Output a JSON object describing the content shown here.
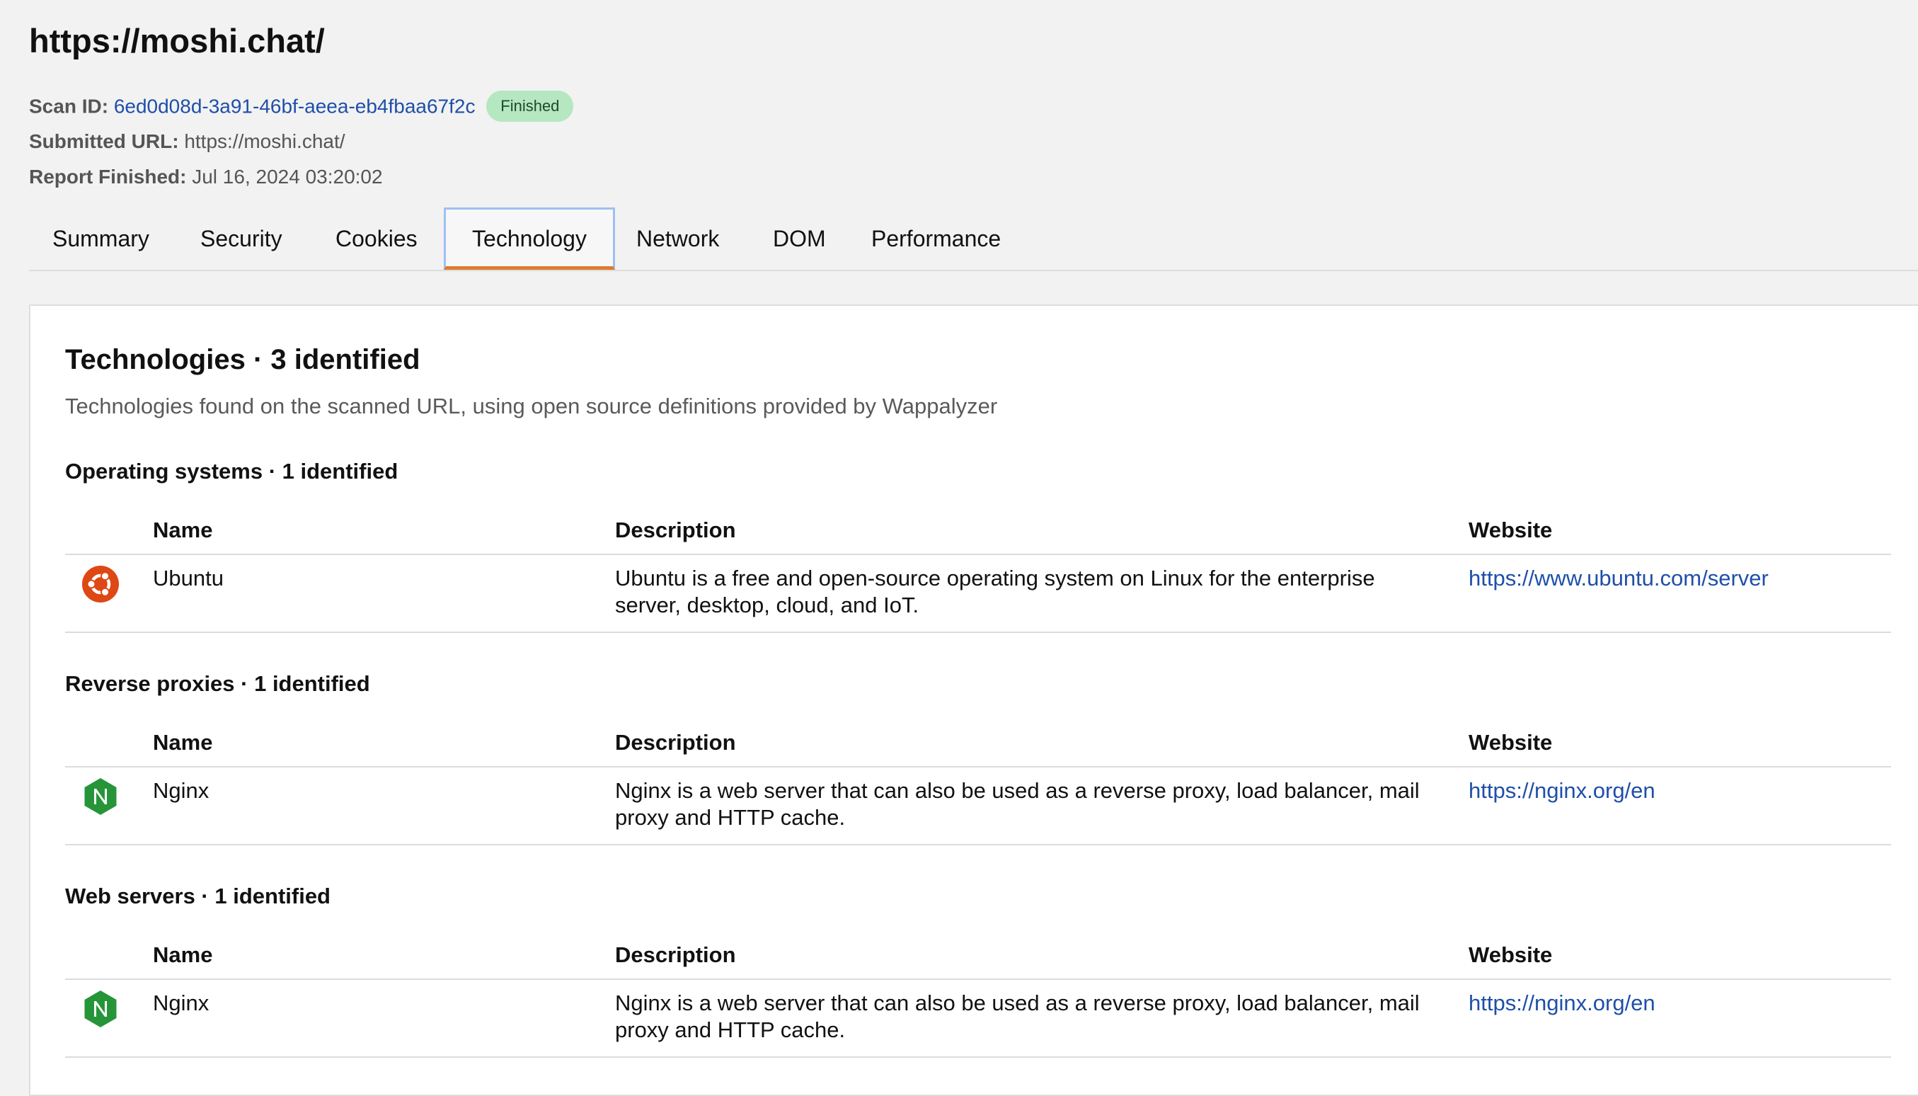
{
  "header": {
    "title": "https://moshi.chat/",
    "scan_id_label": "Scan ID:",
    "scan_id": "6ed0d08d-3a91-46bf-aeea-eb4fbaa67f2c",
    "status_badge": "Finished",
    "submitted_url_label": "Submitted URL:",
    "submitted_url": "https://moshi.chat/",
    "report_finished_label": "Report Finished:",
    "report_finished": "Jul 16, 2024 03:20:02"
  },
  "tabs": [
    {
      "label": "Summary",
      "active": false
    },
    {
      "label": "Security",
      "active": false
    },
    {
      "label": "Cookies",
      "active": false
    },
    {
      "label": "Technology",
      "active": true
    },
    {
      "label": "Network",
      "active": false
    },
    {
      "label": "DOM",
      "active": false
    },
    {
      "label": "Performance",
      "active": false
    }
  ],
  "panel": {
    "title": "Technologies · 3 identified",
    "subtitle": "Technologies found on the scanned URL, using open source definitions provided by Wappalyzer",
    "columns": {
      "name": "Name",
      "description": "Description",
      "website": "Website"
    },
    "sections": [
      {
        "title": "Operating systems · 1 identified",
        "rows": [
          {
            "icon": "ubuntu-logo-icon",
            "name": "Ubuntu",
            "description": "Ubuntu is a free and open-source operating system on Linux for the enterprise server, desktop, cloud, and IoT.",
            "website": "https://www.ubuntu.com/server"
          }
        ]
      },
      {
        "title": "Reverse proxies · 1 identified",
        "rows": [
          {
            "icon": "nginx-logo-icon",
            "name": "Nginx",
            "description": "Nginx is a web server that can also be used as a reverse proxy, load balancer, mail proxy and HTTP cache.",
            "website": "https://nginx.org/en"
          }
        ]
      },
      {
        "title": "Web servers · 1 identified",
        "rows": [
          {
            "icon": "nginx-logo-icon",
            "name": "Nginx",
            "description": "Nginx is a web server that can also be used as a reverse proxy, load balancer, mail proxy and HTTP cache.",
            "website": "https://nginx.org/en"
          }
        ]
      }
    ]
  },
  "colors": {
    "background": "#f2f2f2",
    "link": "#1f4fa8",
    "badge_bg": "#b5e7c0",
    "active_tab_underline": "#e07b2e",
    "ubuntu_orange": "#dd4814",
    "nginx_green": "#269539"
  }
}
